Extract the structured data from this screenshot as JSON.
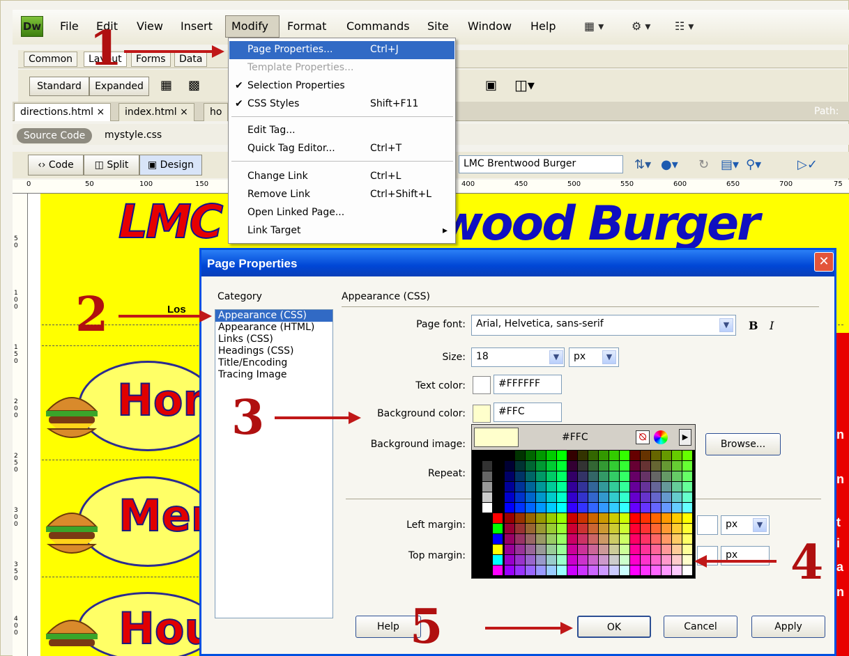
{
  "app": {
    "logo": "Dw"
  },
  "menubar": {
    "items": [
      "File",
      "Edit",
      "View",
      "Insert",
      "Modify",
      "Format",
      "Commands",
      "Site",
      "Window",
      "Help"
    ],
    "toolbar_icons": [
      "layout-icon",
      "gear-icon",
      "site-icon"
    ]
  },
  "insertbar": {
    "tabs": [
      "Common",
      "Layout",
      "Forms",
      "Data"
    ]
  },
  "layoutrow": {
    "standard": "Standard",
    "expanded": "Expanded"
  },
  "doc_tabs": [
    "directions.html",
    "index.html",
    "ho"
  ],
  "path_label": "Path:",
  "related": {
    "source": "Source Code",
    "css": "mystyle.css"
  },
  "view_buttons": [
    "Code",
    "Split",
    "Design"
  ],
  "doc_title": "LMC Brentwood Burger",
  "ruler": {
    "ticks": [
      "0",
      "50",
      "100",
      "150",
      "400",
      "450",
      "500",
      "550",
      "600",
      "650",
      "700",
      "75"
    ]
  },
  "vruler": {
    "ticks": [
      "5 0",
      "1 0 0",
      "1 5 0",
      "2 0 0",
      "2 5 0",
      "3 0 0",
      "3 5 0",
      "4 0 0"
    ]
  },
  "page": {
    "banner_left": "LMC",
    "banner_right": "wood Burger",
    "subtitle": "Los ",
    "nav": [
      "Hom",
      "Men",
      "Hou"
    ],
    "right_chars": [
      "n",
      "n",
      "t",
      "i",
      "a",
      "n"
    ]
  },
  "dropdown": {
    "items": [
      {
        "label": "Page Properties...",
        "shortcut": "Ctrl+J",
        "state": "highlight"
      },
      {
        "label": "Template Properties...",
        "shortcut": "",
        "state": "disabled"
      },
      {
        "label": "Selection Properties",
        "shortcut": "",
        "state": "checked"
      },
      {
        "label": "CSS Styles",
        "shortcut": "Shift+F11",
        "state": "checked"
      },
      {
        "label": "Edit Tag...",
        "shortcut": "",
        "state": ""
      },
      {
        "label": "Quick Tag Editor...",
        "shortcut": "Ctrl+T",
        "state": ""
      },
      {
        "label": "Change Link",
        "shortcut": "Ctrl+L",
        "state": ""
      },
      {
        "label": "Remove Link",
        "shortcut": "Ctrl+Shift+L",
        "state": ""
      },
      {
        "label": "Open Linked Page...",
        "shortcut": "",
        "state": ""
      },
      {
        "label": "Link Target",
        "shortcut": "",
        "state": "submenu"
      }
    ]
  },
  "dialog": {
    "title": "Page Properties",
    "category_label": "Category",
    "categories": [
      "Appearance (CSS)",
      "Appearance (HTML)",
      "Links (CSS)",
      "Headings (CSS)",
      "Title/Encoding",
      "Tracing Image"
    ],
    "section_title": "Appearance (CSS)",
    "page_font_label": "Page font:",
    "page_font": "Arial, Helvetica, sans-serif",
    "bold": "B",
    "italic": "I",
    "size_label": "Size:",
    "size_value": "18",
    "size_unit": "px",
    "text_color_label": "Text color:",
    "text_color": "#FFFFFF",
    "bg_color_label": "Background color:",
    "bg_color": "#FFC",
    "bg_image_label": "Background image:",
    "browse": "Browse...",
    "repeat_label": "Repeat:",
    "left_margin_label": "Left margin:",
    "top_margin_label": "Top margin:",
    "margin_unit": "px",
    "help": "Help",
    "ok": "OK",
    "cancel": "Cancel",
    "apply": "Apply"
  },
  "picker": {
    "value": "#FFC",
    "preview_color": "#ffffcc"
  },
  "annotations": [
    "1",
    "2",
    "3",
    "4",
    "5"
  ]
}
